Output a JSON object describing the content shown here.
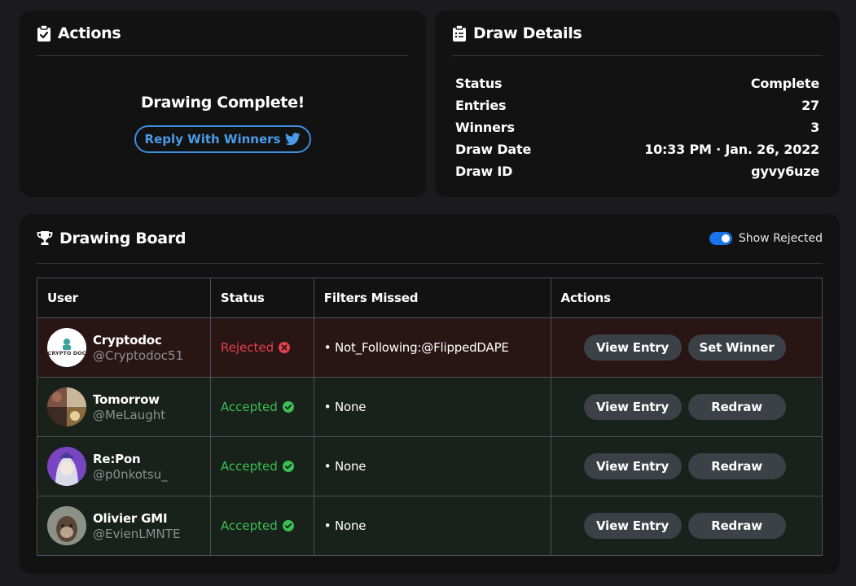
{
  "actions": {
    "title": "Actions",
    "message": "Drawing Complete!",
    "reply_button": "Reply With Winners"
  },
  "details": {
    "title": "Draw Details",
    "rows": [
      {
        "label": "Status",
        "value": "Complete"
      },
      {
        "label": "Entries",
        "value": "27"
      },
      {
        "label": "Winners",
        "value": "3"
      },
      {
        "label": "Draw Date",
        "value": "10:33 PM · Jan. 26, 2022"
      },
      {
        "label": "Draw ID",
        "value": "gyvy6uze"
      }
    ]
  },
  "board": {
    "title": "Drawing Board",
    "toggle_label": "Show Rejected",
    "toggle_on": true,
    "columns": [
      "User",
      "Status",
      "Filters Missed",
      "Actions"
    ],
    "rows": [
      {
        "name": "Cryptodoc",
        "handle": "@Cryptodoc51",
        "status": "Rejected",
        "filter": "• Not_Following:@FlippedDAPE",
        "btn1": "View Entry",
        "btn2": "Set Winner",
        "avatar_text": "CRYPTO DOC"
      },
      {
        "name": "Tomorrow",
        "handle": "@MeLaught",
        "status": "Accepted",
        "filter": "• None",
        "btn1": "View Entry",
        "btn2": "Redraw"
      },
      {
        "name": "Re:Pon",
        "handle": "@p0nkotsu_",
        "status": "Accepted",
        "filter": "• None",
        "btn1": "View Entry",
        "btn2": "Redraw"
      },
      {
        "name": "Olivier GMI",
        "handle": "@EvienLMNTE",
        "status": "Accepted",
        "filter": "• None",
        "btn1": "View Entry",
        "btn2": "Redraw"
      }
    ]
  },
  "colors": {
    "accent": "#3d8fe0",
    "rejected": "#e0414b",
    "accepted": "#3cbf54",
    "rejected_row": "#2a1515",
    "accepted_row": "#18211a"
  }
}
